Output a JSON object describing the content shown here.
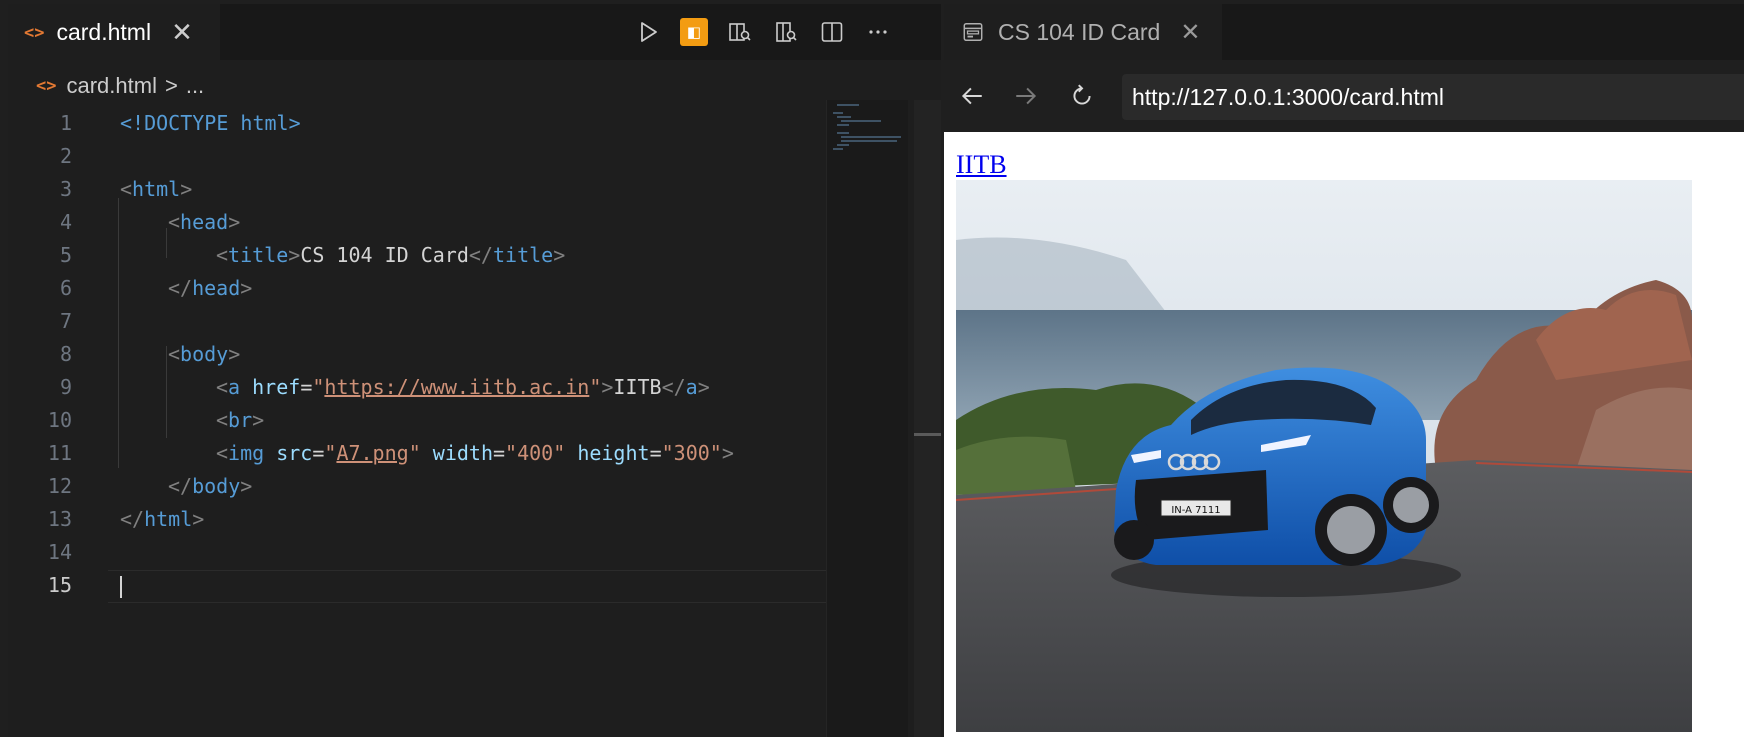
{
  "editor": {
    "tab_label": "card.html",
    "breadcrumb": {
      "file": "card.html",
      "more": "..."
    },
    "current_line": 15,
    "lines": [
      {
        "n": "1"
      },
      {
        "n": "2"
      },
      {
        "n": "3"
      },
      {
        "n": "4"
      },
      {
        "n": "5"
      },
      {
        "n": "6"
      },
      {
        "n": "7"
      },
      {
        "n": "8"
      },
      {
        "n": "9"
      },
      {
        "n": "10"
      },
      {
        "n": "11"
      },
      {
        "n": "12"
      },
      {
        "n": "13"
      },
      {
        "n": "14"
      },
      {
        "n": "15"
      }
    ],
    "code": {
      "doctype": "<!DOCTYPE html>",
      "html_open": "html",
      "head_open": "head",
      "title_tag": "title",
      "title_text": "CS 104 ID Card",
      "body_tag": "body",
      "a_tag": "a",
      "href_attr": "href",
      "href_value": "https://www.iitb.ac.in",
      "link_text": "IITB",
      "br_tag": "br",
      "img_tag": "img",
      "src_attr": "src",
      "src_value": "A7.png",
      "width_attr": "width",
      "width_value": "400",
      "height_attr": "height",
      "height_value": "300"
    },
    "toolbar_icons": [
      "run-icon",
      "preview-extension-icon",
      "open-preview-icon",
      "split-preview-icon",
      "split-editor-icon",
      "more-actions-icon"
    ]
  },
  "preview": {
    "tab_label": "CS 104 ID Card",
    "url": "http://127.0.0.1:3000/card.html",
    "page_link_text": "IITB",
    "plate_text": "IN-A 7111"
  },
  "colors": {
    "accent": "#f39c12",
    "file_icon": "#e37933",
    "link": "#0000ee"
  }
}
